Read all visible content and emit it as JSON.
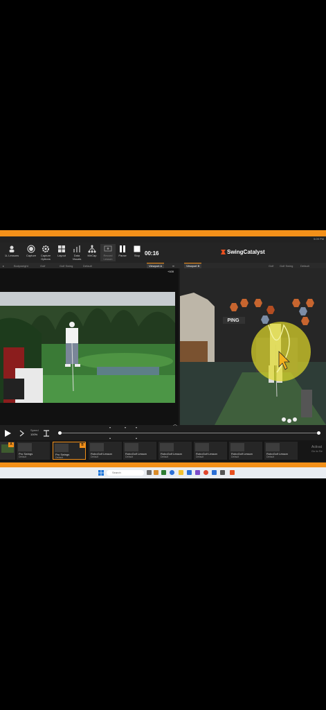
{
  "system": {
    "clock": "5:09 PM"
  },
  "toolbar": {
    "buttons": [
      {
        "label": "1L Lessons"
      },
      {
        "label": "Capture"
      },
      {
        "label": "Capture Options"
      },
      {
        "label": "Layout"
      },
      {
        "label": "Data Visuals"
      },
      {
        "label": "MirCap"
      },
      {
        "label": "Record Lesson"
      },
      {
        "label": "Pause"
      },
      {
        "label": "Stop"
      }
    ],
    "timer": "00:16",
    "brand": "SwingCatalyst"
  },
  "tabsbar": {
    "left_items": [
      "Bodyweight",
      "Golf",
      "Golf Swing",
      "Default"
    ],
    "viewport_a": "Viewport A",
    "viewport_b": "Viewport B",
    "right_items": [
      "Golf",
      "Golf Swing",
      "Default"
    ],
    "zoom": "+100"
  },
  "viewB": {
    "sign": "PING"
  },
  "playback": {
    "speed_label": "Speed",
    "speed_value": "100%"
  },
  "clips": [
    {
      "title": "Pro Swings",
      "sub": "Default",
      "marker": "A"
    },
    {
      "title": "Pro Swings",
      "sub": "Default",
      "marker": "B"
    },
    {
      "title": "RoboGolf Lesson",
      "sub": "Default"
    },
    {
      "title": "RoboGolf Lesson",
      "sub": "Default"
    },
    {
      "title": "RoboGolf Lesson",
      "sub": "Default"
    },
    {
      "title": "RoboGolf Lesson",
      "sub": "Default"
    },
    {
      "title": "RoboGolf Lesson",
      "sub": "Default"
    },
    {
      "title": "RoboGolf Lesson",
      "sub": "Default"
    }
  ],
  "watermark": {
    "line1": "Activat",
    "line2": "Go to Se"
  },
  "taskbar": {
    "search_placeholder": "Search"
  },
  "colors": {
    "accent": "#f39019",
    "highlight": "#e3dc2a"
  }
}
